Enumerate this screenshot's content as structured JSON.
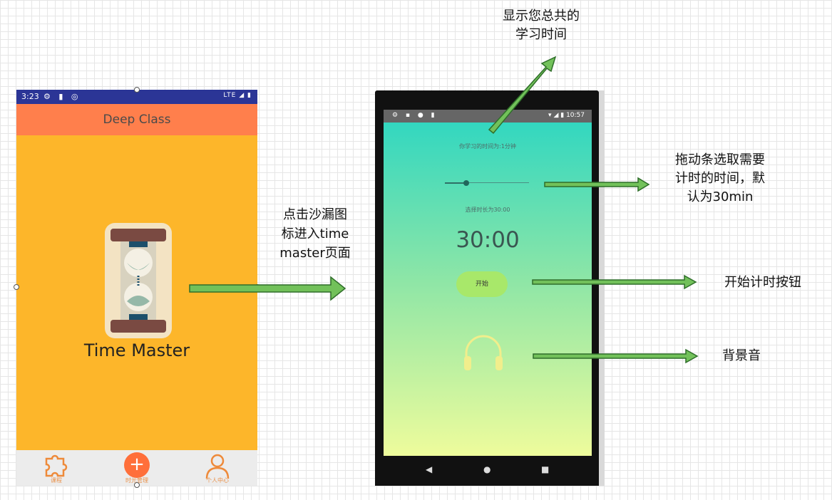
{
  "left_phone": {
    "status_time": "3:23",
    "status_right": "LTE",
    "header_title": "Deep Class",
    "app_label": "Time Master",
    "nav": [
      {
        "label": "课程",
        "icon": "puzzle-icon"
      },
      {
        "label": "时光管理",
        "icon": "plus-icon"
      },
      {
        "label": "个人中心",
        "icon": "person-icon"
      }
    ],
    "colors": {
      "background": "#fdb62a",
      "header": "#ff7f4c",
      "status_bar": "#2b3596"
    }
  },
  "right_phone": {
    "status_time": "10:57",
    "study_time_text": "你学习的时间为:1分钟",
    "selected_duration_text": "选择时长为30:00",
    "timer": "30:00",
    "start_button": "开始",
    "slider_value_fraction": 0.25,
    "background_icon": "headphone-icon",
    "colors": {
      "gradient_top": "#2bd6c2",
      "gradient_bottom": "#eefc9c",
      "button": "#a8e86a"
    }
  },
  "annotations": {
    "total_time": [
      "显示您总共的",
      "学习时间"
    ],
    "tap_hourglass": [
      "点击沙漏图",
      "标进入time",
      "master页面"
    ],
    "drag_slider": [
      "拖动条选取需要",
      "计时的时间，默",
      "认为30min"
    ],
    "start_button": "开始计时按钮",
    "background_music": "背景音"
  }
}
